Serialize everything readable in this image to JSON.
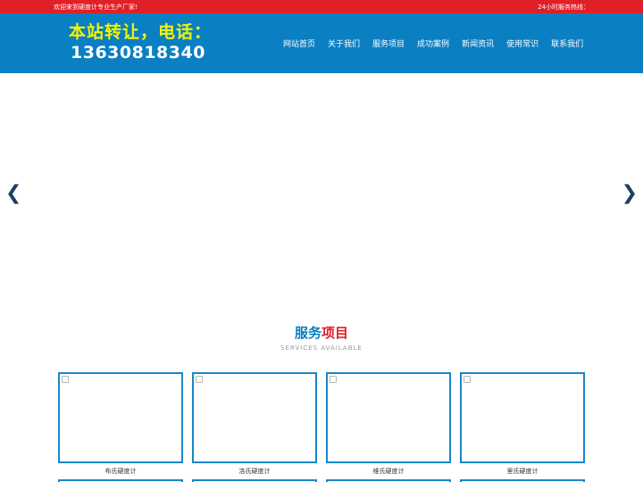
{
  "topbar": {
    "welcome": "欢迎来到硬度计专业生产厂家!",
    "hotline": "24小时服务热线："
  },
  "header": {
    "logo_line1": "本站转让，电话：",
    "logo_line2": "13630818340"
  },
  "nav": {
    "items": [
      "网站首页",
      "关于我们",
      "服务项目",
      "成功案例",
      "新闻资讯",
      "使用常识",
      "联系我们"
    ]
  },
  "banner": {
    "prev_glyph": "❮",
    "next_glyph": "❯"
  },
  "services": {
    "title_part1": "服务",
    "title_part2": "项目",
    "subtitle": "SERVICES AVAILABLE",
    "items": [
      "布氏硬度计",
      "洛氏硬度计",
      "维氏硬度计",
      "里氏硬度计"
    ]
  },
  "colors": {
    "topbar_red": "#e02027",
    "header_blue": "#0a7fc2",
    "logo_yellow": "#f4f400",
    "card_border": "#1a86c8"
  }
}
